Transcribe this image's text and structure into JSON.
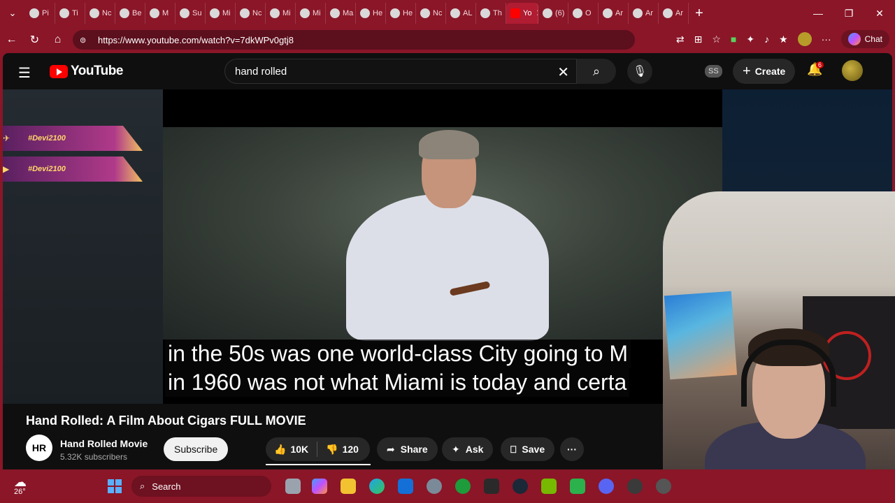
{
  "tabs": [
    {
      "label": "Pi"
    },
    {
      "label": "Ti"
    },
    {
      "label": "Nc"
    },
    {
      "label": "Be"
    },
    {
      "label": "M"
    },
    {
      "label": "Su"
    },
    {
      "label": "Mi"
    },
    {
      "label": "Nc"
    },
    {
      "label": "Mi"
    },
    {
      "label": "Mi"
    },
    {
      "label": "Ma"
    },
    {
      "label": "He"
    },
    {
      "label": "He"
    },
    {
      "label": "Nc"
    },
    {
      "label": "AL"
    },
    {
      "label": "Th"
    },
    {
      "label": "Yo"
    },
    {
      "label": "(6)"
    },
    {
      "label": "O"
    },
    {
      "label": "Ar"
    },
    {
      "label": "Ar"
    },
    {
      "label": "Ar"
    }
  ],
  "browser": {
    "url": "https://www.youtube.com/watch?v=7dkWPv0gtj8",
    "chat_label": "Chat"
  },
  "youtube": {
    "logo_text": "YouTube",
    "search_value": "hand rolled",
    "account_badge": "SS",
    "create_label": "Create",
    "notification_count": "6"
  },
  "overlay": {
    "banners": [
      "#Devi2100",
      "#Devi2100"
    ]
  },
  "video": {
    "caption_lines": [
      "in the 50s was one world-class City going to M",
      "in 1960 was not what Miami is today and certa"
    ],
    "title": "Hand Rolled: A Film About Cigars FULL MOVIE",
    "channel_initials": "HR",
    "channel_name": "Hand Rolled Movie",
    "subscribers": "5.32K subscribers",
    "subscribe_label": "Subscribe",
    "likes": "10K",
    "dislikes": "120",
    "share_label": "Share",
    "ask_label": "Ask",
    "save_label": "Save"
  },
  "taskbar": {
    "temperature": "26°",
    "search_label": "Search"
  }
}
